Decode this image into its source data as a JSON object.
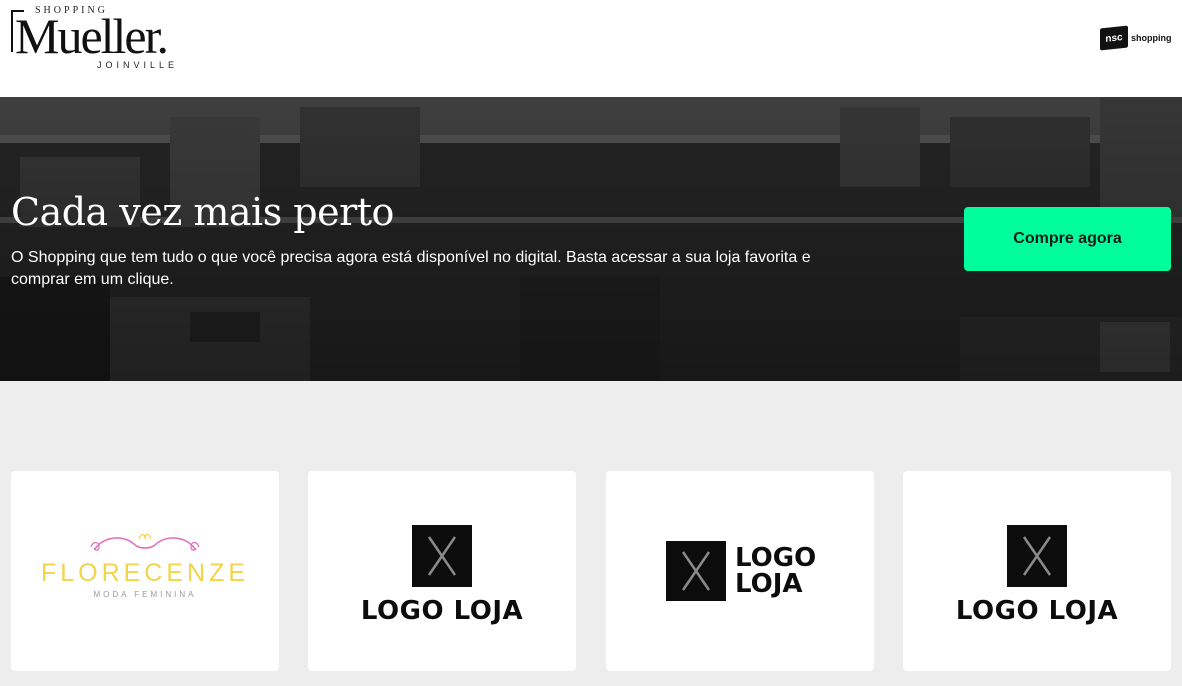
{
  "header": {
    "brand": {
      "top_line": "SHOPPING",
      "name": "Mueller.",
      "city": "JOINVILLE"
    },
    "partner": {
      "mark": "nsc",
      "text": "shopping"
    }
  },
  "hero": {
    "title": "Cada vez mais perto",
    "description": "O Shopping que tem tudo o que você precisa agora está disponível no digital. Basta acessar a sua loja favorita e comprar em um clique.",
    "cta_label": "Compre agora",
    "cta_color": "#00ff9c"
  },
  "stores": [
    {
      "name": "FLORECENZE",
      "subtitle": "MODA FEMININA",
      "icon": "ornament-icon"
    },
    {
      "name": "LOGO LOJA",
      "icon": "x-logo-icon"
    },
    {
      "line1": "LOGO",
      "line2": "LOJA",
      "icon": "x-logo-icon"
    },
    {
      "name": "LOGO LOJA",
      "icon": "x-logo-icon"
    }
  ]
}
